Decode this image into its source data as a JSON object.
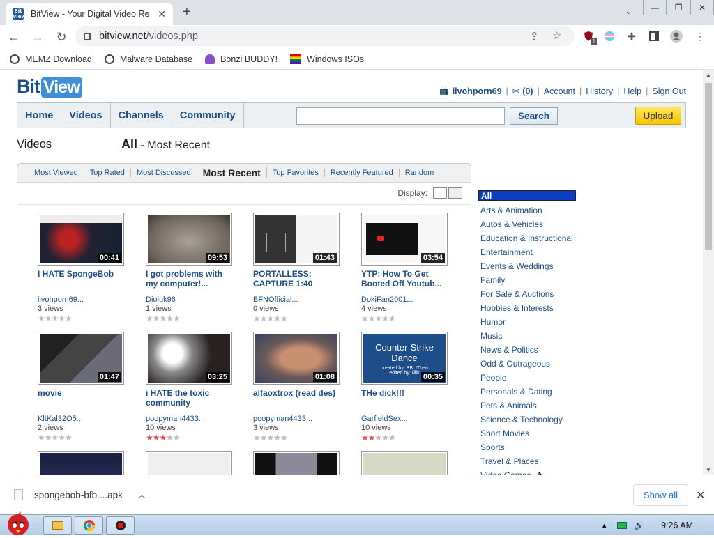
{
  "browser": {
    "tab_title": "BitView - Your Digital Video Re",
    "tab_favicon_text": "Bit View",
    "url_host": "bitview.net",
    "url_path": "/videos.php",
    "extension_badge": "1",
    "bookmarks": [
      "MEMZ Download",
      "Malware Database",
      "Bonzi BUDDY!",
      "Windows ISOs"
    ]
  },
  "site": {
    "logo_bit": "Bit",
    "logo_view": "View",
    "user": {
      "username": "iivohporn69",
      "inbox_count": "(0)",
      "links": [
        "Account",
        "History",
        "Help",
        "Sign Out"
      ]
    },
    "nav": {
      "items": [
        "Home",
        "Videos",
        "Channels",
        "Community"
      ],
      "search_button": "Search",
      "upload_button": "Upload"
    },
    "page_title": "Videos",
    "section_title": "All",
    "section_subtitle": " - Most Recent",
    "subtabs": [
      "Most Viewed",
      "Top Rated",
      "Most Discussed",
      "Most Recent",
      "Top Favorites",
      "Recently Featured",
      "Random"
    ],
    "active_subtab": "Most Recent",
    "display_label": "Display:",
    "videos": [
      {
        "title": "I HATE SpongeBob",
        "user": "iivohporn69...",
        "views": "3 views",
        "duration": "00:41",
        "stars": 0
      },
      {
        "title": "I got problems with my computer!...",
        "user": "Dioluk96",
        "views": "1 views",
        "duration": "09:53",
        "stars": 0
      },
      {
        "title": "PORTALLESS: CAPTURE 1:40",
        "user": "BFNOfficial...",
        "views": "0 views",
        "duration": "01:43",
        "stars": 0
      },
      {
        "title": "YTP: How To Get Booted Off Youtub...",
        "user": "DokiFan2001...",
        "views": "4 views",
        "duration": "03:54",
        "stars": 0
      },
      {
        "title": "movie",
        "user": "KltKal32O5...",
        "views": "2 views",
        "duration": "01:47",
        "stars": 0
      },
      {
        "title": "i HATE the toxic community",
        "user": "poopyman4433...",
        "views": "10 views",
        "duration": "03:25",
        "stars": 3
      },
      {
        "title": "alfaoxtrox (read des)",
        "user": "poopyman4433...",
        "views": "3 views",
        "duration": "01:08",
        "stars": 0
      },
      {
        "title": "THe dick!!!",
        "user": "GarfieldSex...",
        "views": "10 views",
        "duration": "00:35",
        "stars": 2
      }
    ],
    "thumb8_text": "Counter-Strike Dance",
    "thumb8_sub1": "created by: BB_ITben",
    "thumb8_sub2": "edited by: Mik",
    "categories": [
      "All",
      "Arts & Animation",
      "Autos & Vehicles",
      "Education & Instructional",
      "Entertainment",
      "Events & Weddings",
      "Family",
      "For Sale & Auctions",
      "Hobbies & Interests",
      "Humor",
      "Music",
      "News & Politics",
      "Odd & Outrageous",
      "People",
      "Personals & Dating",
      "Pets & Animals",
      "Science & Technology",
      "Short Movies",
      "Sports",
      "Travel & Places",
      "Video Games"
    ]
  },
  "downloads": {
    "file_name": "spongebob-bfb....apk",
    "show_all": "Show all"
  },
  "taskbar": {
    "time": "9:26 AM"
  }
}
